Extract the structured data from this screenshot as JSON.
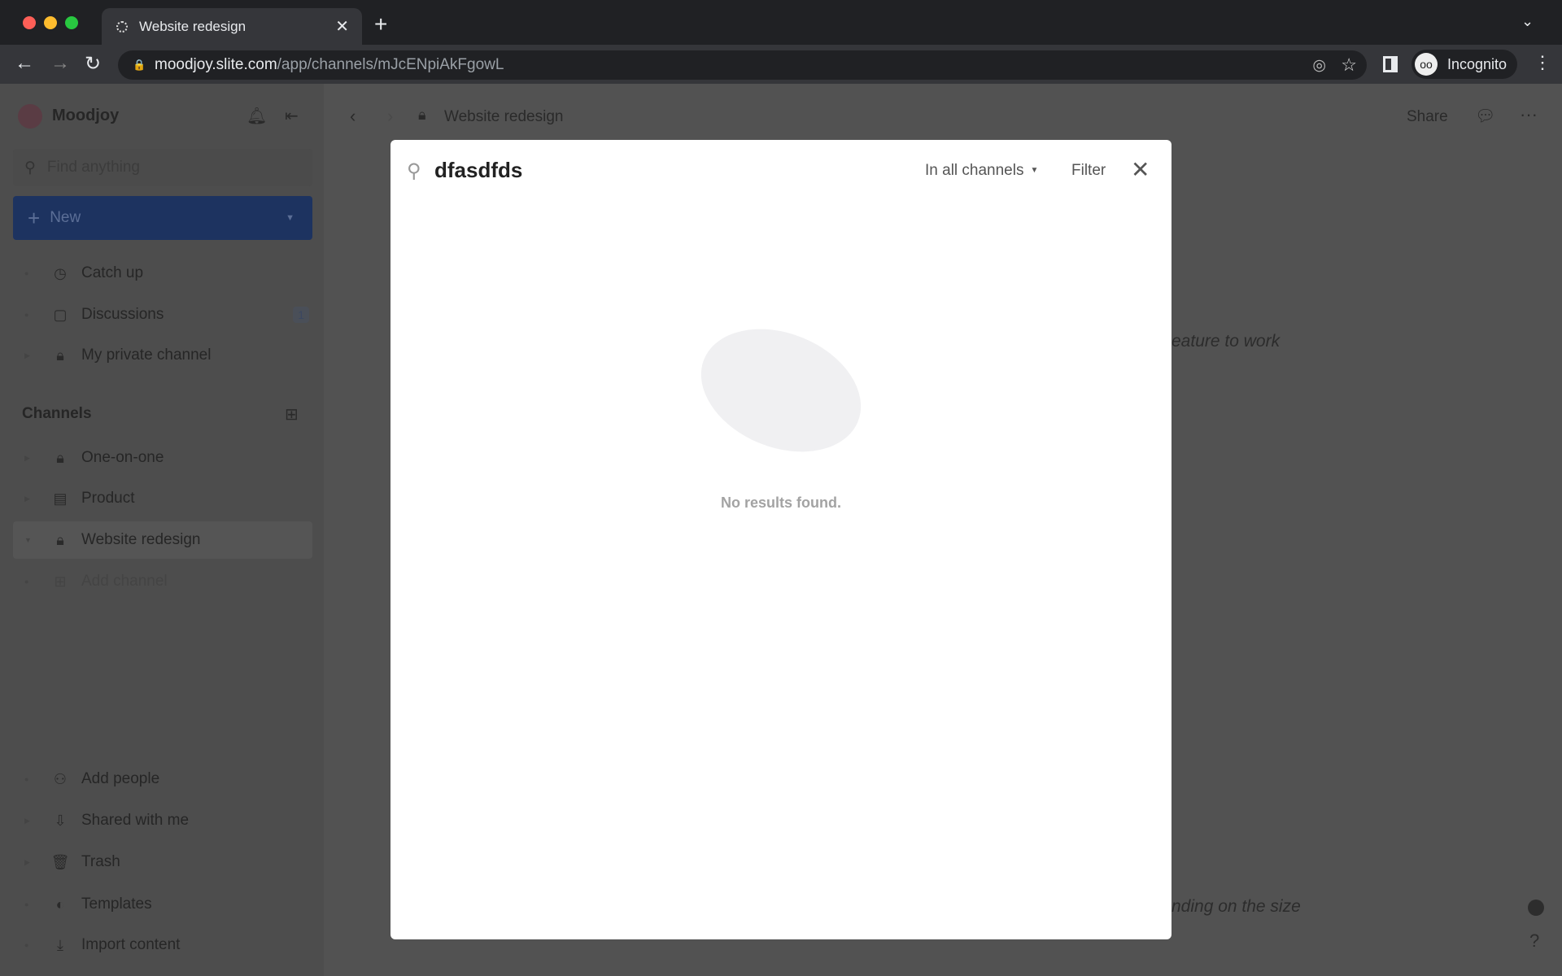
{
  "browser": {
    "tab_title": "Website redesign",
    "url_host": "moodjoy.slite.com",
    "url_path": "/app/channels/mJcENpiAkFgowL",
    "profile": "Incognito"
  },
  "sidebar": {
    "workspace": "Moodjoy",
    "search_placeholder": "Find anything",
    "new_label": "New",
    "top_items": [
      {
        "label": "Catch up",
        "icon": "clock-icon"
      },
      {
        "label": "Discussions",
        "icon": "chat-icon",
        "badge": "1"
      },
      {
        "label": "My private channel",
        "icon": "lock-icon"
      }
    ],
    "channels_heading": "Channels",
    "channels": [
      {
        "label": "One-on-one",
        "icon": "lock-icon"
      },
      {
        "label": "Product",
        "icon": "doc-icon"
      },
      {
        "label": "Website redesign",
        "icon": "lock-icon",
        "selected": true
      },
      {
        "label": "Add channel",
        "icon": "add-channel-icon"
      }
    ],
    "bottom_items": [
      {
        "label": "Add people",
        "icon": "add-person-icon"
      },
      {
        "label": "Shared with me",
        "icon": "inbox-icon"
      },
      {
        "label": "Trash",
        "icon": "trash-icon"
      },
      {
        "label": "Templates",
        "icon": "templates-icon"
      },
      {
        "label": "Import content",
        "icon": "download-icon"
      }
    ]
  },
  "header": {
    "breadcrumb": "Website redesign",
    "share": "Share"
  },
  "background_text": {
    "line1": "eature to work",
    "line2": "nding on the size"
  },
  "search_modal": {
    "query": "dfasdfds",
    "scope": "In all channels",
    "filter": "Filter",
    "empty_message": "No results found."
  },
  "colors": {
    "accent": "#1d3360",
    "overlay": "#525252"
  }
}
